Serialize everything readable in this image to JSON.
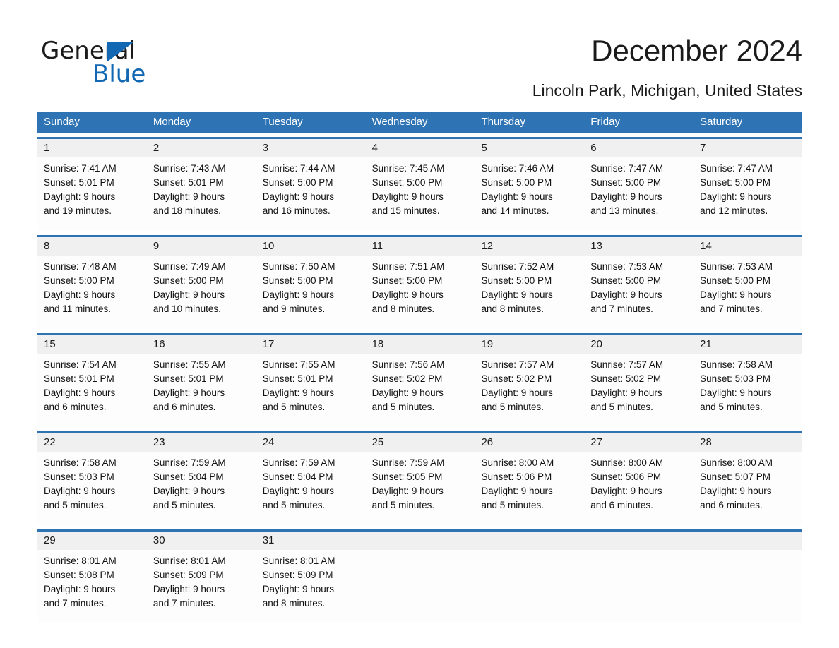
{
  "brand": {
    "name_primary": "General",
    "name_secondary": "Blue"
  },
  "header": {
    "title": "December 2024",
    "subtitle": "Lincoln Park, Michigan, United States"
  },
  "colors": {
    "header_blue": "#2e74b5",
    "logo_blue": "#1268b3",
    "day_number_band": "#f0f0f0",
    "text": "#111111"
  },
  "calendar": {
    "day_headers": [
      "Sunday",
      "Monday",
      "Tuesday",
      "Wednesday",
      "Thursday",
      "Friday",
      "Saturday"
    ],
    "weeks": [
      {
        "days": [
          {
            "num": "1",
            "sunrise": "Sunrise: 7:41 AM",
            "sunset": "Sunset: 5:01 PM",
            "daylight_1": "Daylight: 9 hours",
            "daylight_2": "and 19 minutes."
          },
          {
            "num": "2",
            "sunrise": "Sunrise: 7:43 AM",
            "sunset": "Sunset: 5:01 PM",
            "daylight_1": "Daylight: 9 hours",
            "daylight_2": "and 18 minutes."
          },
          {
            "num": "3",
            "sunrise": "Sunrise: 7:44 AM",
            "sunset": "Sunset: 5:00 PM",
            "daylight_1": "Daylight: 9 hours",
            "daylight_2": "and 16 minutes."
          },
          {
            "num": "4",
            "sunrise": "Sunrise: 7:45 AM",
            "sunset": "Sunset: 5:00 PM",
            "daylight_1": "Daylight: 9 hours",
            "daylight_2": "and 15 minutes."
          },
          {
            "num": "5",
            "sunrise": "Sunrise: 7:46 AM",
            "sunset": "Sunset: 5:00 PM",
            "daylight_1": "Daylight: 9 hours",
            "daylight_2": "and 14 minutes."
          },
          {
            "num": "6",
            "sunrise": "Sunrise: 7:47 AM",
            "sunset": "Sunset: 5:00 PM",
            "daylight_1": "Daylight: 9 hours",
            "daylight_2": "and 13 minutes."
          },
          {
            "num": "7",
            "sunrise": "Sunrise: 7:47 AM",
            "sunset": "Sunset: 5:00 PM",
            "daylight_1": "Daylight: 9 hours",
            "daylight_2": "and 12 minutes."
          }
        ]
      },
      {
        "days": [
          {
            "num": "8",
            "sunrise": "Sunrise: 7:48 AM",
            "sunset": "Sunset: 5:00 PM",
            "daylight_1": "Daylight: 9 hours",
            "daylight_2": "and 11 minutes."
          },
          {
            "num": "9",
            "sunrise": "Sunrise: 7:49 AM",
            "sunset": "Sunset: 5:00 PM",
            "daylight_1": "Daylight: 9 hours",
            "daylight_2": "and 10 minutes."
          },
          {
            "num": "10",
            "sunrise": "Sunrise: 7:50 AM",
            "sunset": "Sunset: 5:00 PM",
            "daylight_1": "Daylight: 9 hours",
            "daylight_2": "and 9 minutes."
          },
          {
            "num": "11",
            "sunrise": "Sunrise: 7:51 AM",
            "sunset": "Sunset: 5:00 PM",
            "daylight_1": "Daylight: 9 hours",
            "daylight_2": "and 8 minutes."
          },
          {
            "num": "12",
            "sunrise": "Sunrise: 7:52 AM",
            "sunset": "Sunset: 5:00 PM",
            "daylight_1": "Daylight: 9 hours",
            "daylight_2": "and 8 minutes."
          },
          {
            "num": "13",
            "sunrise": "Sunrise: 7:53 AM",
            "sunset": "Sunset: 5:00 PM",
            "daylight_1": "Daylight: 9 hours",
            "daylight_2": "and 7 minutes."
          },
          {
            "num": "14",
            "sunrise": "Sunrise: 7:53 AM",
            "sunset": "Sunset: 5:00 PM",
            "daylight_1": "Daylight: 9 hours",
            "daylight_2": "and 7 minutes."
          }
        ]
      },
      {
        "days": [
          {
            "num": "15",
            "sunrise": "Sunrise: 7:54 AM",
            "sunset": "Sunset: 5:01 PM",
            "daylight_1": "Daylight: 9 hours",
            "daylight_2": "and 6 minutes."
          },
          {
            "num": "16",
            "sunrise": "Sunrise: 7:55 AM",
            "sunset": "Sunset: 5:01 PM",
            "daylight_1": "Daylight: 9 hours",
            "daylight_2": "and 6 minutes."
          },
          {
            "num": "17",
            "sunrise": "Sunrise: 7:55 AM",
            "sunset": "Sunset: 5:01 PM",
            "daylight_1": "Daylight: 9 hours",
            "daylight_2": "and 5 minutes."
          },
          {
            "num": "18",
            "sunrise": "Sunrise: 7:56 AM",
            "sunset": "Sunset: 5:02 PM",
            "daylight_1": "Daylight: 9 hours",
            "daylight_2": "and 5 minutes."
          },
          {
            "num": "19",
            "sunrise": "Sunrise: 7:57 AM",
            "sunset": "Sunset: 5:02 PM",
            "daylight_1": "Daylight: 9 hours",
            "daylight_2": "and 5 minutes."
          },
          {
            "num": "20",
            "sunrise": "Sunrise: 7:57 AM",
            "sunset": "Sunset: 5:02 PM",
            "daylight_1": "Daylight: 9 hours",
            "daylight_2": "and 5 minutes."
          },
          {
            "num": "21",
            "sunrise": "Sunrise: 7:58 AM",
            "sunset": "Sunset: 5:03 PM",
            "daylight_1": "Daylight: 9 hours",
            "daylight_2": "and 5 minutes."
          }
        ]
      },
      {
        "days": [
          {
            "num": "22",
            "sunrise": "Sunrise: 7:58 AM",
            "sunset": "Sunset: 5:03 PM",
            "daylight_1": "Daylight: 9 hours",
            "daylight_2": "and 5 minutes."
          },
          {
            "num": "23",
            "sunrise": "Sunrise: 7:59 AM",
            "sunset": "Sunset: 5:04 PM",
            "daylight_1": "Daylight: 9 hours",
            "daylight_2": "and 5 minutes."
          },
          {
            "num": "24",
            "sunrise": "Sunrise: 7:59 AM",
            "sunset": "Sunset: 5:04 PM",
            "daylight_1": "Daylight: 9 hours",
            "daylight_2": "and 5 minutes."
          },
          {
            "num": "25",
            "sunrise": "Sunrise: 7:59 AM",
            "sunset": "Sunset: 5:05 PM",
            "daylight_1": "Daylight: 9 hours",
            "daylight_2": "and 5 minutes."
          },
          {
            "num": "26",
            "sunrise": "Sunrise: 8:00 AM",
            "sunset": "Sunset: 5:06 PM",
            "daylight_1": "Daylight: 9 hours",
            "daylight_2": "and 5 minutes."
          },
          {
            "num": "27",
            "sunrise": "Sunrise: 8:00 AM",
            "sunset": "Sunset: 5:06 PM",
            "daylight_1": "Daylight: 9 hours",
            "daylight_2": "and 6 minutes."
          },
          {
            "num": "28",
            "sunrise": "Sunrise: 8:00 AM",
            "sunset": "Sunset: 5:07 PM",
            "daylight_1": "Daylight: 9 hours",
            "daylight_2": "and 6 minutes."
          }
        ]
      },
      {
        "days": [
          {
            "num": "29",
            "sunrise": "Sunrise: 8:01 AM",
            "sunset": "Sunset: 5:08 PM",
            "daylight_1": "Daylight: 9 hours",
            "daylight_2": "and 7 minutes."
          },
          {
            "num": "30",
            "sunrise": "Sunrise: 8:01 AM",
            "sunset": "Sunset: 5:09 PM",
            "daylight_1": "Daylight: 9 hours",
            "daylight_2": "and 7 minutes."
          },
          {
            "num": "31",
            "sunrise": "Sunrise: 8:01 AM",
            "sunset": "Sunset: 5:09 PM",
            "daylight_1": "Daylight: 9 hours",
            "daylight_2": "and 8 minutes."
          },
          {
            "num": "",
            "sunrise": "",
            "sunset": "",
            "daylight_1": "",
            "daylight_2": ""
          },
          {
            "num": "",
            "sunrise": "",
            "sunset": "",
            "daylight_1": "",
            "daylight_2": ""
          },
          {
            "num": "",
            "sunrise": "",
            "sunset": "",
            "daylight_1": "",
            "daylight_2": ""
          },
          {
            "num": "",
            "sunrise": "",
            "sunset": "",
            "daylight_1": "",
            "daylight_2": ""
          }
        ]
      }
    ]
  }
}
